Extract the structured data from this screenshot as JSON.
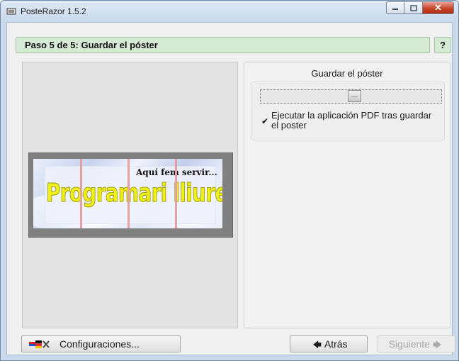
{
  "window": {
    "title": "PosteRazor 1.5.2",
    "controls": {
      "minimize": "▭",
      "maximize": "▢",
      "close": "✕"
    }
  },
  "step": {
    "title": "Paso 5 de 5: Guardar el póster",
    "help_label": "?"
  },
  "preview": {
    "poster_subtitle": "Aquí fem servir...",
    "poster_title": "Programari lliure"
  },
  "settings": {
    "title": "Guardar el póster",
    "slider": {
      "icon": "slider-handle"
    },
    "checkbox": {
      "checked": true,
      "mark": "✔",
      "label": "Ejecutar la aplicación PDF tras guardar el poster"
    }
  },
  "footer": {
    "config_label": "Configuraciones...",
    "back_label": "Atrás",
    "back_arrow": "🡄",
    "next_label": "Siguiente",
    "next_arrow": "🡆"
  },
  "colors": {
    "step_bar": "#d6ebd3",
    "poster_text": "#f0ef1b",
    "cut_lines": "#e6a0a3"
  }
}
